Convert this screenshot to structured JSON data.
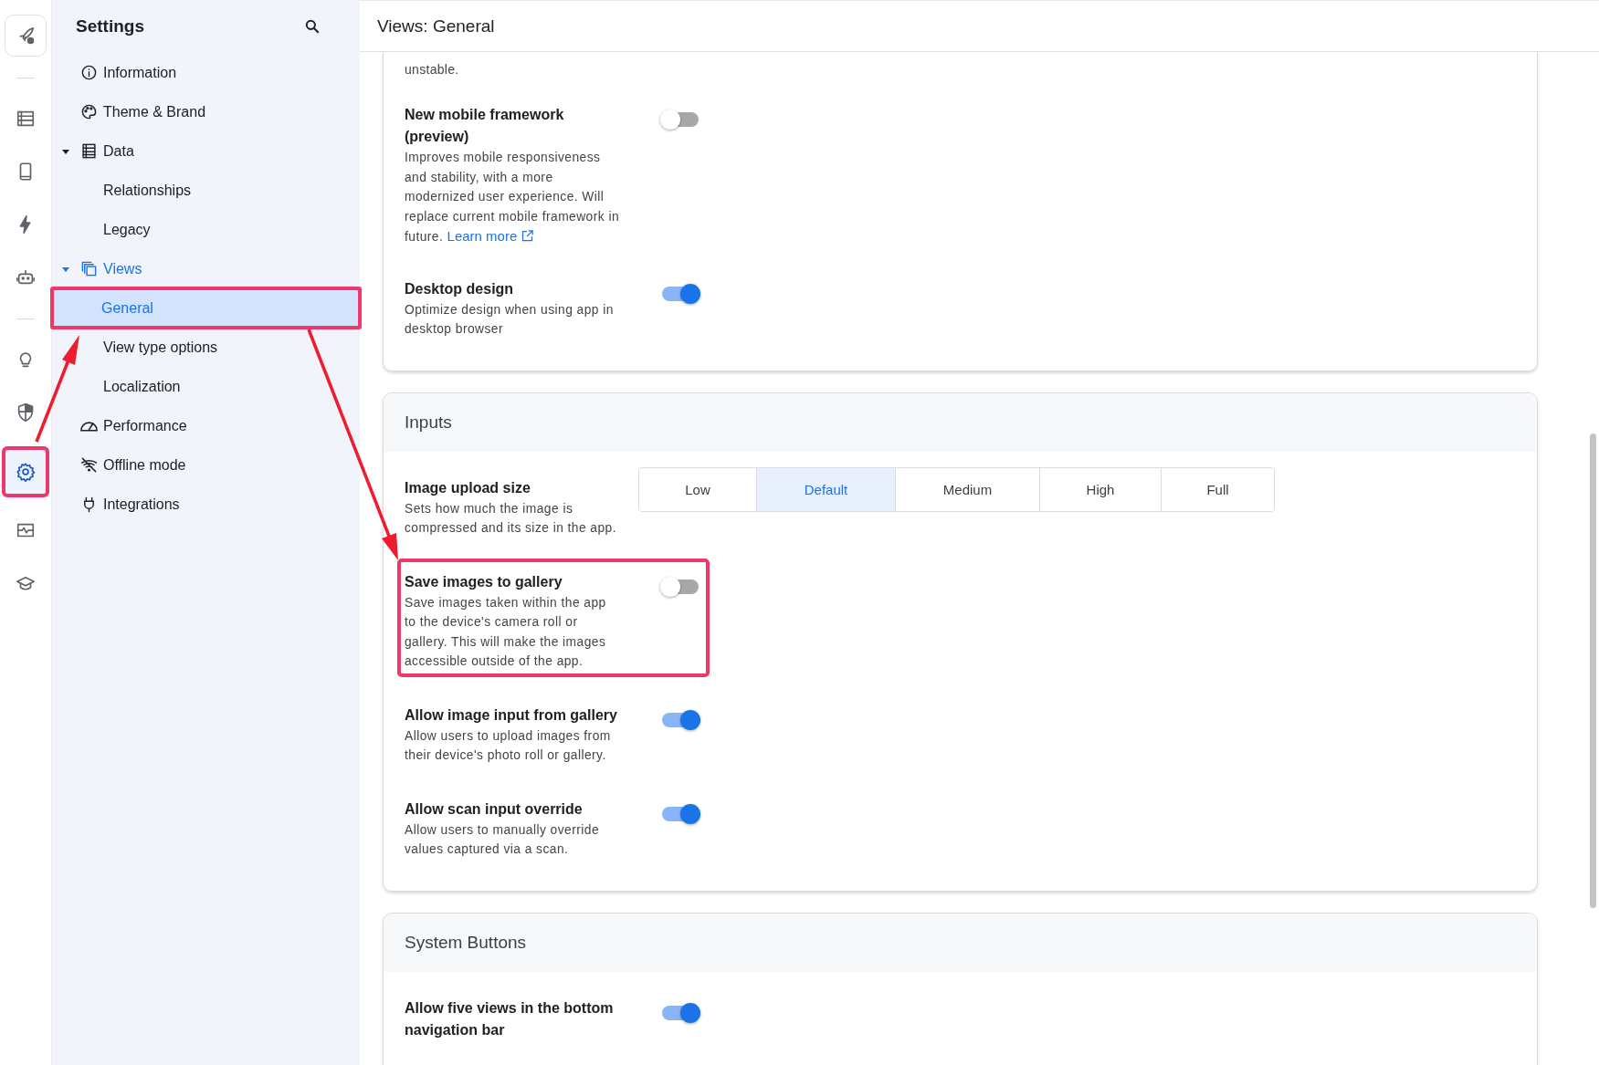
{
  "rail": {
    "items": [
      {
        "kind": "rocket",
        "selected": false,
        "highlighted": false
      },
      {
        "kind": "divider"
      },
      {
        "kind": "list",
        "selected": false,
        "highlighted": false
      },
      {
        "kind": "phone",
        "selected": false,
        "highlighted": false
      },
      {
        "kind": "bolt",
        "selected": false,
        "highlighted": false
      },
      {
        "kind": "robot",
        "selected": false,
        "highlighted": false
      },
      {
        "kind": "divider"
      },
      {
        "kind": "bulb",
        "selected": false,
        "highlighted": false
      },
      {
        "kind": "shield",
        "selected": false,
        "highlighted": false
      },
      {
        "kind": "gear",
        "selected": true,
        "highlighted": true
      },
      {
        "kind": "monitor",
        "selected": false,
        "highlighted": false
      },
      {
        "kind": "cap",
        "selected": false,
        "highlighted": false
      }
    ]
  },
  "sidebar": {
    "title": "Settings",
    "items": [
      {
        "label": "Information",
        "kind": "info",
        "selected": false
      },
      {
        "label": "Theme & Brand",
        "kind": "palette",
        "selected": false
      },
      {
        "label": "Data",
        "kind": "table",
        "selected": false,
        "expanded": true,
        "children": [
          {
            "label": "Relationships",
            "selected": false
          },
          {
            "label": "Legacy",
            "selected": false
          }
        ]
      },
      {
        "label": "Views",
        "kind": "views",
        "selected": false,
        "expanded": true,
        "children": [
          {
            "label": "General",
            "selected": true,
            "highlighted": true
          },
          {
            "label": "View type options",
            "selected": false
          },
          {
            "label": "Localization",
            "selected": false
          }
        ]
      },
      {
        "label": "Performance",
        "kind": "gauge",
        "selected": false
      },
      {
        "label": "Offline mode",
        "kind": "offline",
        "selected": false
      },
      {
        "label": "Integrations",
        "kind": "plug",
        "selected": false
      }
    ]
  },
  "main": {
    "title": "Views: General",
    "sections": [
      {
        "settings": [
          {
            "kind": "note",
            "description": "unstable."
          },
          {
            "kind": "toggle",
            "title": "New mobile framework (preview)",
            "description": "Improves mobile responsiveness and stability, with a more modernized user experience. Will replace current mobile framework in future.",
            "link": "Learn more",
            "on": false
          },
          {
            "kind": "toggle",
            "title": "Desktop design",
            "description": "Optimize design when using app in desktop browser",
            "on": true
          }
        ]
      },
      {
        "heading": "Inputs",
        "settings": [
          {
            "kind": "segmented",
            "title": "Image upload size",
            "description": "Sets how much the image is compressed and its size in the app.",
            "options": [
              {
                "label": "Low",
                "selected": false
              },
              {
                "label": "Default",
                "selected": true
              },
              {
                "label": "Medium",
                "selected": false
              },
              {
                "label": "High",
                "selected": false
              },
              {
                "label": "Full",
                "selected": false
              }
            ]
          },
          {
            "kind": "toggle",
            "title": "Save images to gallery",
            "description": "Save images taken within the app to the device's camera roll or gallery. This will make the images accessible outside of the app.",
            "on": false,
            "highlighted": true
          },
          {
            "kind": "toggle",
            "title": "Allow image input from gallery",
            "description": "Allow users to upload images from their device's photo roll or gallery.",
            "on": true
          },
          {
            "kind": "toggle",
            "title": "Allow scan input override",
            "description": "Allow users to manually override values captured via a scan.",
            "on": true
          }
        ]
      },
      {
        "heading": "System Buttons",
        "settings": [
          {
            "kind": "toggle",
            "title": "Allow five views in the bottom navigation bar",
            "on": true
          }
        ]
      }
    ]
  }
}
